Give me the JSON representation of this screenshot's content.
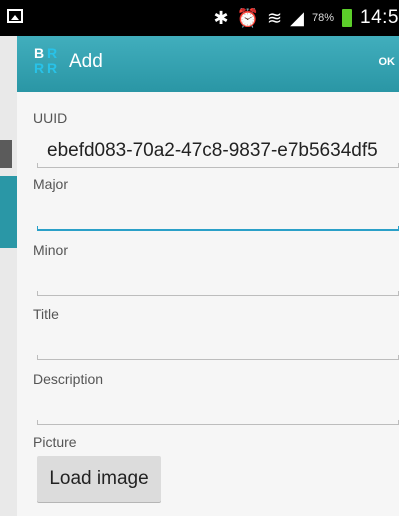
{
  "statusbar": {
    "battery_pct": "78%",
    "time": "14:5"
  },
  "actionbar": {
    "logo_letters": [
      "B",
      "R",
      "R",
      "R"
    ],
    "title": "Add",
    "ok_label": "OK"
  },
  "form": {
    "uuid_label": "UUID",
    "uuid_value": "ebefd083-70a2-47c8-9837-e7b5634df5",
    "major_label": "Major",
    "minor_label": "Minor",
    "title_label": "Title",
    "description_label": "Description",
    "picture_label": "Picture",
    "load_image_label": "Load image"
  },
  "colors": {
    "accent": "#2a96a5",
    "focus_line": "#2aa0c8",
    "battery": "#5ccf2a"
  }
}
